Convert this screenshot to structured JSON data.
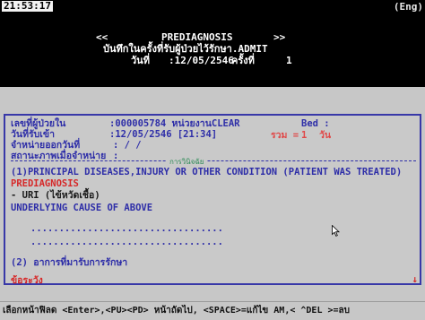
{
  "header": {
    "clock": "21:53:17",
    "mode": "(Eng)",
    "nav_prev": "<<",
    "title": "PREDIAGNOSIS",
    "nav_next": ">>",
    "subtitle": "บันทึกในครั้งที่รับผู้ป่วยไว้รักษา.ADMIT",
    "date_label": "วันที่",
    "date_value": ":12/05/2546",
    "count_label": "ครั้งที่",
    "count_value": "1"
  },
  "info": {
    "hn_label": "เลขที่ผู้ป่วยใน",
    "hn_value": ":000005784 หน่วยงานCLEAR",
    "bed_label": "Bed :",
    "admit_label": "วันที่รับเข้า",
    "admit_value": ":12/05/2546 [21:34]",
    "days_label": "รวม =",
    "days_value": "1",
    "days_unit": "วัน",
    "discharge_label": "จำหน่ายออกวันที่",
    "discharge_value": ": / /",
    "status_label": "สถานะภาพเมื่อจำหน่าย",
    "status_value": ":"
  },
  "section": {
    "label": "การวินิจฉัย"
  },
  "diagnosis": {
    "heading": "(1)PRINCIPAL DISEASES,INJURY OR OTHER CONDITION (PATIENT WAS TREATED)",
    "category": "PREDIAGNOSIS",
    "value": "- URI (ไข้หวัดเชื้อ)",
    "underlying_heading": "UNDERLYING CAUSE OF ABOVE",
    "dots1": "..................................",
    "dots2": "..................................",
    "second_heading": "(2) อาการที่มารับการรักษา",
    "note_label": "ข้อระวัง",
    "scroll_arrow": "↓"
  },
  "status_bar": {
    "text": "เลือกหน้าฟิลด <Enter>,<PU><PD> หน้าถัดไป, <SPACE>=แก้ไข AM,< ^DEL >=ลบ"
  },
  "colors": {
    "header_bg": "#000000",
    "screen_bg": "#c7c7c7",
    "panel_border": "#3838a8",
    "text_blue": "#2e2ea8",
    "text_red": "#d62828"
  }
}
